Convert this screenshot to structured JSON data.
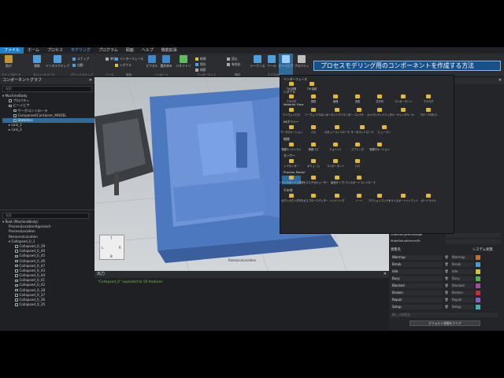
{
  "menu": {
    "items": [
      "ファイル",
      "ホーム",
      "プロセス",
      "モデリング",
      "プログラム",
      "図面",
      "ヘルプ",
      "機能拡張"
    ],
    "active": "モデリング"
  },
  "ribbon": {
    "clipboard_group": "クリップボード",
    "big_buttons": [
      {
        "label": "貼付",
        "color": "#c79434"
      },
      {
        "label": "移動",
        "color": "#4aa0e0"
      },
      {
        "label": "インタラクティブ",
        "color": "#4aa0e0"
      },
      {
        "label": "ピクセル",
        "color": "#3b8ad0"
      },
      {
        "label": "選択済み",
        "color": "#3b8ad0"
      },
      {
        "label": "ジオメトリ",
        "color": "#5cc05a"
      },
      {
        "label": "シーケンス",
        "color": "#4aa0e0"
      },
      {
        "label": "ツール",
        "color": "#4aa0e0"
      },
      {
        "label": "ビヘイビア",
        "color": "#4aa0e0"
      },
      {
        "label": "プロパティ",
        "color": "#c0c0c0"
      }
    ],
    "small_items": [
      "スナップ",
      "自動",
      "単位",
      "インターフェース",
      "シグナル",
      "新規",
      "保存",
      "検索",
      "読込",
      "有効化",
      "チェック",
      "エクスポート"
    ],
    "groups": [
      "クリップボード",
      "モジュールコード",
      "グリッドスナップ",
      "ツール",
      "接続",
      "インポート",
      "コンポーネント",
      "構成",
      "エクスポート"
    ]
  },
  "title_banner": "プロセスモデリング用のコンポーネントを作成する方法",
  "left_panel": {
    "title": "コンポーネントグラフ",
    "search_placeholder": "検索",
    "tree_top": [
      "MachineBody",
      "プロパティ",
      "ビヘイビア",
      "サーボコントローラ",
      "ComponentContainer_MODEL",
      "Statistics",
      "Link_1",
      "Link_2"
    ],
    "bottom_search": "検索",
    "tree_bottom": [
      "Root (MachineBody)",
      "ProcessLocationApproach",
      "ProcessLocation",
      "ResourceLocation",
      "Collapsed_0_1",
      "Collapsed_0_39",
      "Collapsed_0_40",
      "Collapsed_0_45",
      "Collapsed_0_46",
      "Collapsed_0_47",
      "Collapsed_0_43",
      "Collapsed_0_44",
      "Collapsed_0_41",
      "Collapsed_0_42",
      "Collapsed_0_38",
      "Collapsed_0_37",
      "Collapsed_0_36",
      "Collapsed_0_35"
    ]
  },
  "viewport": {
    "label": "ResourceLocation",
    "nav": [
      "T",
      "L",
      "R",
      "B"
    ]
  },
  "output": {
    "title": "出力",
    "message": "\"Collapsed_0\" exploded to 50 features"
  },
  "popup": {
    "sections": [
      {
        "name": "インターフェース",
        "items": [
          "TW-制御",
          "TW-接続"
        ]
      },
      {
        "name": "シグナル",
        "items": [
          "アナログ",
          "関数",
          "論理",
          "変数",
          "文字列",
          "コンポーネント",
          "アナログ"
        ]
      },
      {
        "name": "Material Flow",
        "items": [
          "ワンウェイパス",
          "ツーウェイパス",
          "コンポーネントクリエイター",
          "コンテナ",
          "キャパシティリミッタ",
          "ルーティングルール",
          "フロープロセス"
        ]
      },
      {
        "name": "IMポリシー",
        "items": [
          "ワークロケーション",
          "パス",
          "ロボットコントローラ",
          "サーボコントローラ",
          "ヒューマン"
        ]
      },
      {
        "name": "物理",
        "items": [
          "物理エンティティ",
          "物理パス",
          "ジョイント",
          "スプリング",
          "物理ロケーション"
        ]
      },
      {
        "name": "センサー",
        "items": [
          "レイセンサー",
          "ボリューム",
          "コンポーネント",
          "パス"
        ]
      },
      {
        "name": "Process Model",
        "items": [
          "トランスポートリンク",
          "プロセスエグゼキューター",
          "製品タイプ",
          "トランスポートコントローラ"
        ]
      },
      {
        "name": "その他",
        "items": [
          "ボディカウンター",
          "プロセスフローエディター",
          "ハンドリング",
          "ノート",
          "アクションコンテナ",
          "トランスポートインプット",
          "ポートラベル"
        ]
      }
    ]
  },
  "right_panel": {
    "rows_top": [
      "StateSetupPercentage",
      "StateSetupIntervalPc"
    ],
    "header_left": "状態名",
    "header_right": "システム状態",
    "states": [
      {
        "name": "Warmup",
        "value": "Warmup",
        "color": "#c07030"
      },
      {
        "name": "Break",
        "value": "Break",
        "color": "#4a9ad0"
      },
      {
        "name": "Idle",
        "value": "Idle",
        "color": "#d0c040"
      },
      {
        "name": "Busy",
        "value": "Busy",
        "color": "#50b050"
      },
      {
        "name": "Blocked",
        "value": "Blocked",
        "color": "#a050a0"
      },
      {
        "name": "Broken",
        "value": "Broken",
        "color": "#c03030"
      },
      {
        "name": "Repair",
        "value": "Repair",
        "color": "#8060c0"
      },
      {
        "name": "Setup",
        "value": "Setup",
        "color": "#40b0b0"
      }
    ],
    "add_placeholder": "新しい状態名",
    "default_button": "デフォルト状態をクリア"
  }
}
